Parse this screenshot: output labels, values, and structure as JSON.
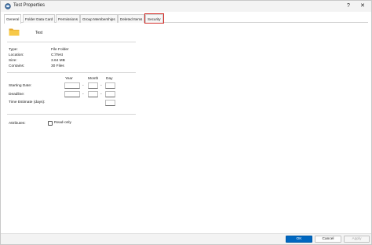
{
  "window": {
    "title": "Test Properties",
    "help_label": "?",
    "close_label": "✕"
  },
  "tabs": [
    {
      "label": "General",
      "active": true
    },
    {
      "label": "Folder Data Card"
    },
    {
      "label": "Permissions"
    },
    {
      "label": "Group Memberships"
    },
    {
      "label": "Deleted Items"
    },
    {
      "label": "Security",
      "highlighted": true
    }
  ],
  "general": {
    "folder_name": "Test",
    "properties": [
      {
        "label": "Type:",
        "value": "File Folder"
      },
      {
        "label": "Location:",
        "value": "C:\\Test"
      },
      {
        "label": "Size:",
        "value": "3.64 MB"
      },
      {
        "label": "Contains:",
        "value": "30 Files"
      }
    ],
    "date_columns": {
      "year": "Year",
      "month": "Month",
      "day": "Day"
    },
    "starting_date_label": "Starting Date:",
    "deadline_label": "Deadline:",
    "time_estimate_label": "Time Estimate (days):",
    "dash": "-",
    "attributes_label": "Attributes:",
    "readonly_label": "Read-only",
    "readonly_checked": false
  },
  "buttons": {
    "ok": "OK",
    "cancel": "Cancel",
    "apply": "Apply"
  },
  "colors": {
    "accent": "#0067c0",
    "highlight": "#d6332f",
    "folder": "#f2c14e"
  }
}
